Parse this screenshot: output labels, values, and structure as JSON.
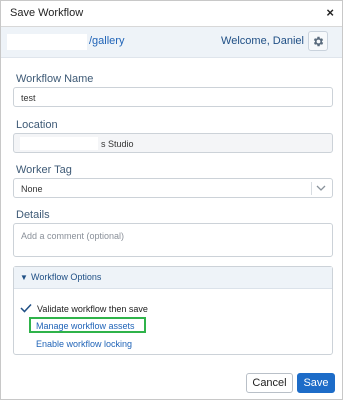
{
  "dialog": {
    "title": "Save Workflow",
    "close_glyph": "×"
  },
  "header": {
    "url_suffix": "/gallery",
    "welcome": "Welcome, Daniel",
    "settings_icon": "gear-icon"
  },
  "form": {
    "workflow_name": {
      "label": "Workflow Name",
      "value": "test"
    },
    "location": {
      "label": "Location",
      "value_suffix": "s Studio"
    },
    "worker_tag": {
      "label": "Worker Tag",
      "value": "None"
    },
    "details": {
      "label": "Details",
      "placeholder": "Add a comment (optional)"
    }
  },
  "options": {
    "title": "Workflow Options",
    "toggle_glyph": "▼",
    "validate": {
      "label": "Validate workflow then save",
      "checked": true
    },
    "manage_assets": "Manage workflow assets",
    "enable_locking": "Enable workflow locking",
    "highlight_color": "#2fb34a"
  },
  "footer": {
    "cancel": "Cancel",
    "save": "Save"
  },
  "colors": {
    "accent": "#1d6cc8",
    "link": "#1f63b7",
    "header_bg": "#eef3f8"
  }
}
